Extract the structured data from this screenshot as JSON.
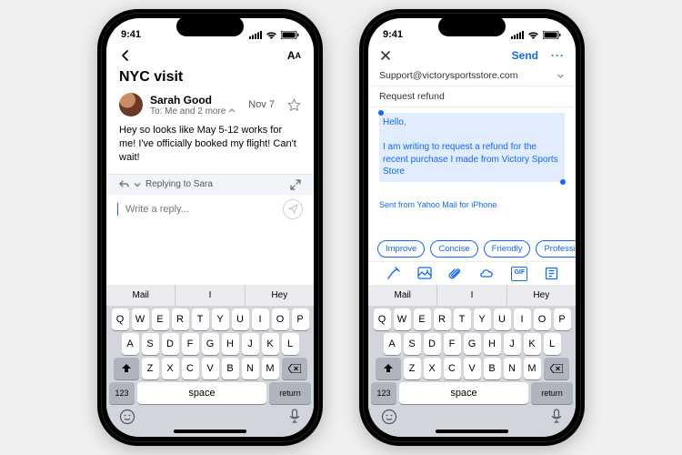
{
  "status": {
    "time": "9:41"
  },
  "left": {
    "title": "NYC visit",
    "sender_name": "Sarah Good",
    "recipients": "To: Me and 2 more",
    "date": "Nov 7",
    "body": "Hey so looks like May 5-12 works for me! I've officially booked my flight! Can't wait!",
    "replying_to": "Replying to Sara",
    "compose_placeholder": "Write a reply...",
    "suggestions": [
      "Mail",
      "I",
      "Hey"
    ]
  },
  "right": {
    "send_label": "Send",
    "to_addr": "Support@victorysportsstore.com",
    "subject": "Request refund",
    "sel_line1": "Hello,",
    "sel_line2": "I am writing to request a refund for the recent purchase I made from Victory Sports Store",
    "signature": "Sent from Yahoo Mail for iPhone",
    "chips": [
      "Improve",
      "Concise",
      "Friendly",
      "Professional"
    ],
    "suggestions": [
      "Mail",
      "I",
      "Hey"
    ]
  },
  "keyboard": {
    "row1": [
      "Q",
      "W",
      "E",
      "R",
      "T",
      "Y",
      "U",
      "I",
      "O",
      "P"
    ],
    "row2": [
      "A",
      "S",
      "D",
      "F",
      "G",
      "H",
      "J",
      "K",
      "L"
    ],
    "row3": [
      "Z",
      "X",
      "C",
      "V",
      "B",
      "N",
      "M"
    ],
    "num": "123",
    "space": "space",
    "return": "return"
  }
}
